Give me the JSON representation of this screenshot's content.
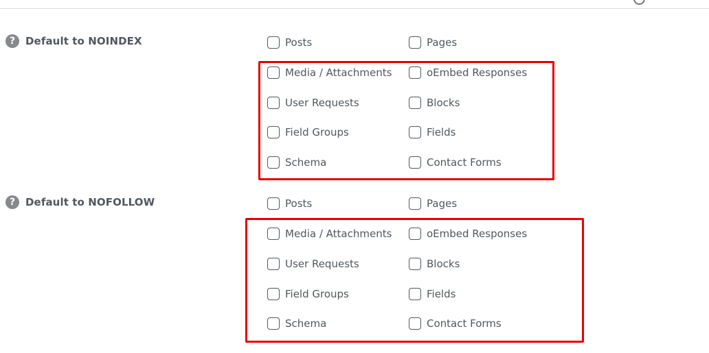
{
  "sections": [
    {
      "label": "Default to NOINDEX",
      "options": [
        "Posts",
        "Pages",
        "Media / Attachments",
        "oEmbed Responses",
        "User Requests",
        "Blocks",
        "Field Groups",
        "Fields",
        "Schema",
        "Contact Forms"
      ]
    },
    {
      "label": "Default to NOFOLLOW",
      "options": [
        "Posts",
        "Pages",
        "Media / Attachments",
        "oEmbed Responses",
        "User Requests",
        "Blocks",
        "Field Groups",
        "Fields",
        "Schema",
        "Contact Forms"
      ]
    }
  ],
  "icons": {
    "help": "question-mark-circle-icon"
  },
  "colors": {
    "highlight_border": "#e60000",
    "label_text": "#50575e",
    "help_icon_bg": "#87898d"
  }
}
